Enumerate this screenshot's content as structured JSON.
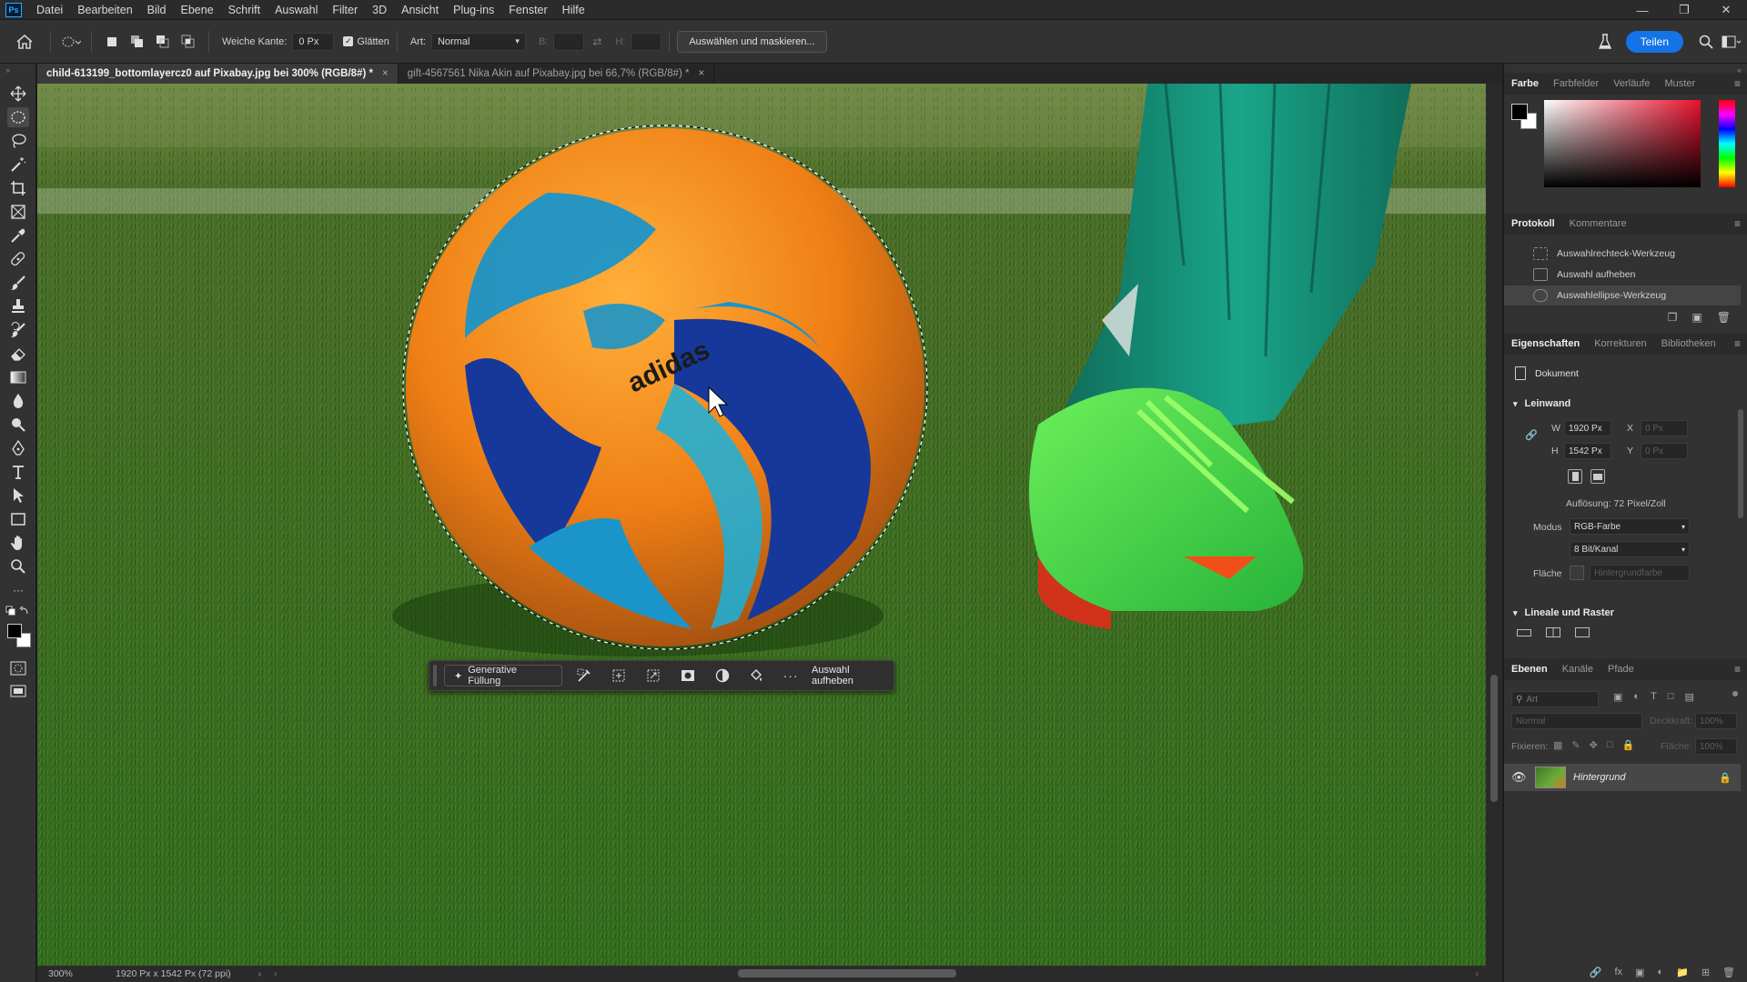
{
  "menu": [
    "Datei",
    "Bearbeiten",
    "Bild",
    "Ebene",
    "Schrift",
    "Auswahl",
    "Filter",
    "3D",
    "Ansicht",
    "Plug-ins",
    "Fenster",
    "Hilfe"
  ],
  "options": {
    "feather_label": "Weiche Kante:",
    "feather_value": "0 Px",
    "antialias_label": "Glätten",
    "style_label": "Art:",
    "style_value": "Normal",
    "width_label": "B:",
    "height_label": "H:",
    "select_mask_label": "Auswählen und maskieren...",
    "share_label": "Teilen"
  },
  "tabs": [
    {
      "label": "child-613199_bottomlayercz0 auf Pixabay.jpg bei 300% (RGB/8#) *",
      "close": "×"
    },
    {
      "label": "gift-4567561 Nika Akin auf Pixabay.jpg bei 66,7% (RGB/8#) *",
      "close": "×"
    }
  ],
  "taskbar": {
    "generative_fill": "Generative Füllung",
    "more": "···",
    "deselect": "Auswahl aufheben"
  },
  "status": {
    "zoom": "300%",
    "doc_info": "1920 Px x 1542 Px (72 ppi)"
  },
  "color_panel": {
    "tabs": [
      "Farbe",
      "Farbfelder",
      "Verläufe",
      "Muster"
    ],
    "foreground": "#000000",
    "background": "#ffffff",
    "hue_base": "#e8112d"
  },
  "history_panel": {
    "tabs": [
      "Protokoll",
      "Kommentare"
    ],
    "items": [
      "Auswahlrechteck-Werkzeug",
      "Auswahl aufheben",
      "Auswahlellipse-Werkzeug"
    ]
  },
  "properties_panel": {
    "tabs": [
      "Eigenschaften",
      "Korrekturen",
      "Bibliotheken"
    ],
    "doc_label": "Dokument",
    "canvas_section": "Leinwand",
    "w_label": "W",
    "w_value": "1920 Px",
    "x_label": "X",
    "x_value": "0 Px",
    "h_label": "H",
    "h_value": "1542 Px",
    "y_label": "Y",
    "y_value": "0 Px",
    "resolution": "Auflösung: 72 Pixel/Zoll",
    "mode_label": "Modus",
    "mode_value": "RGB-Farbe",
    "depth_value": "8 Bit/Kanal",
    "fill_label": "Fläche",
    "fill_value": "Hintergrundfarbe",
    "rulers_section": "Lineale und Raster"
  },
  "layers_panel": {
    "tabs": [
      "Ebenen",
      "Kanäle",
      "Pfade"
    ],
    "search_placeholder": "Art",
    "blend_mode": "Normal",
    "opacity_label": "Deckkraft:",
    "opacity_value": "100%",
    "lock_label": "Fixieren:",
    "fill_label": "Fläche:",
    "fill_value": "100%",
    "layer_name": "Hintergrund"
  }
}
